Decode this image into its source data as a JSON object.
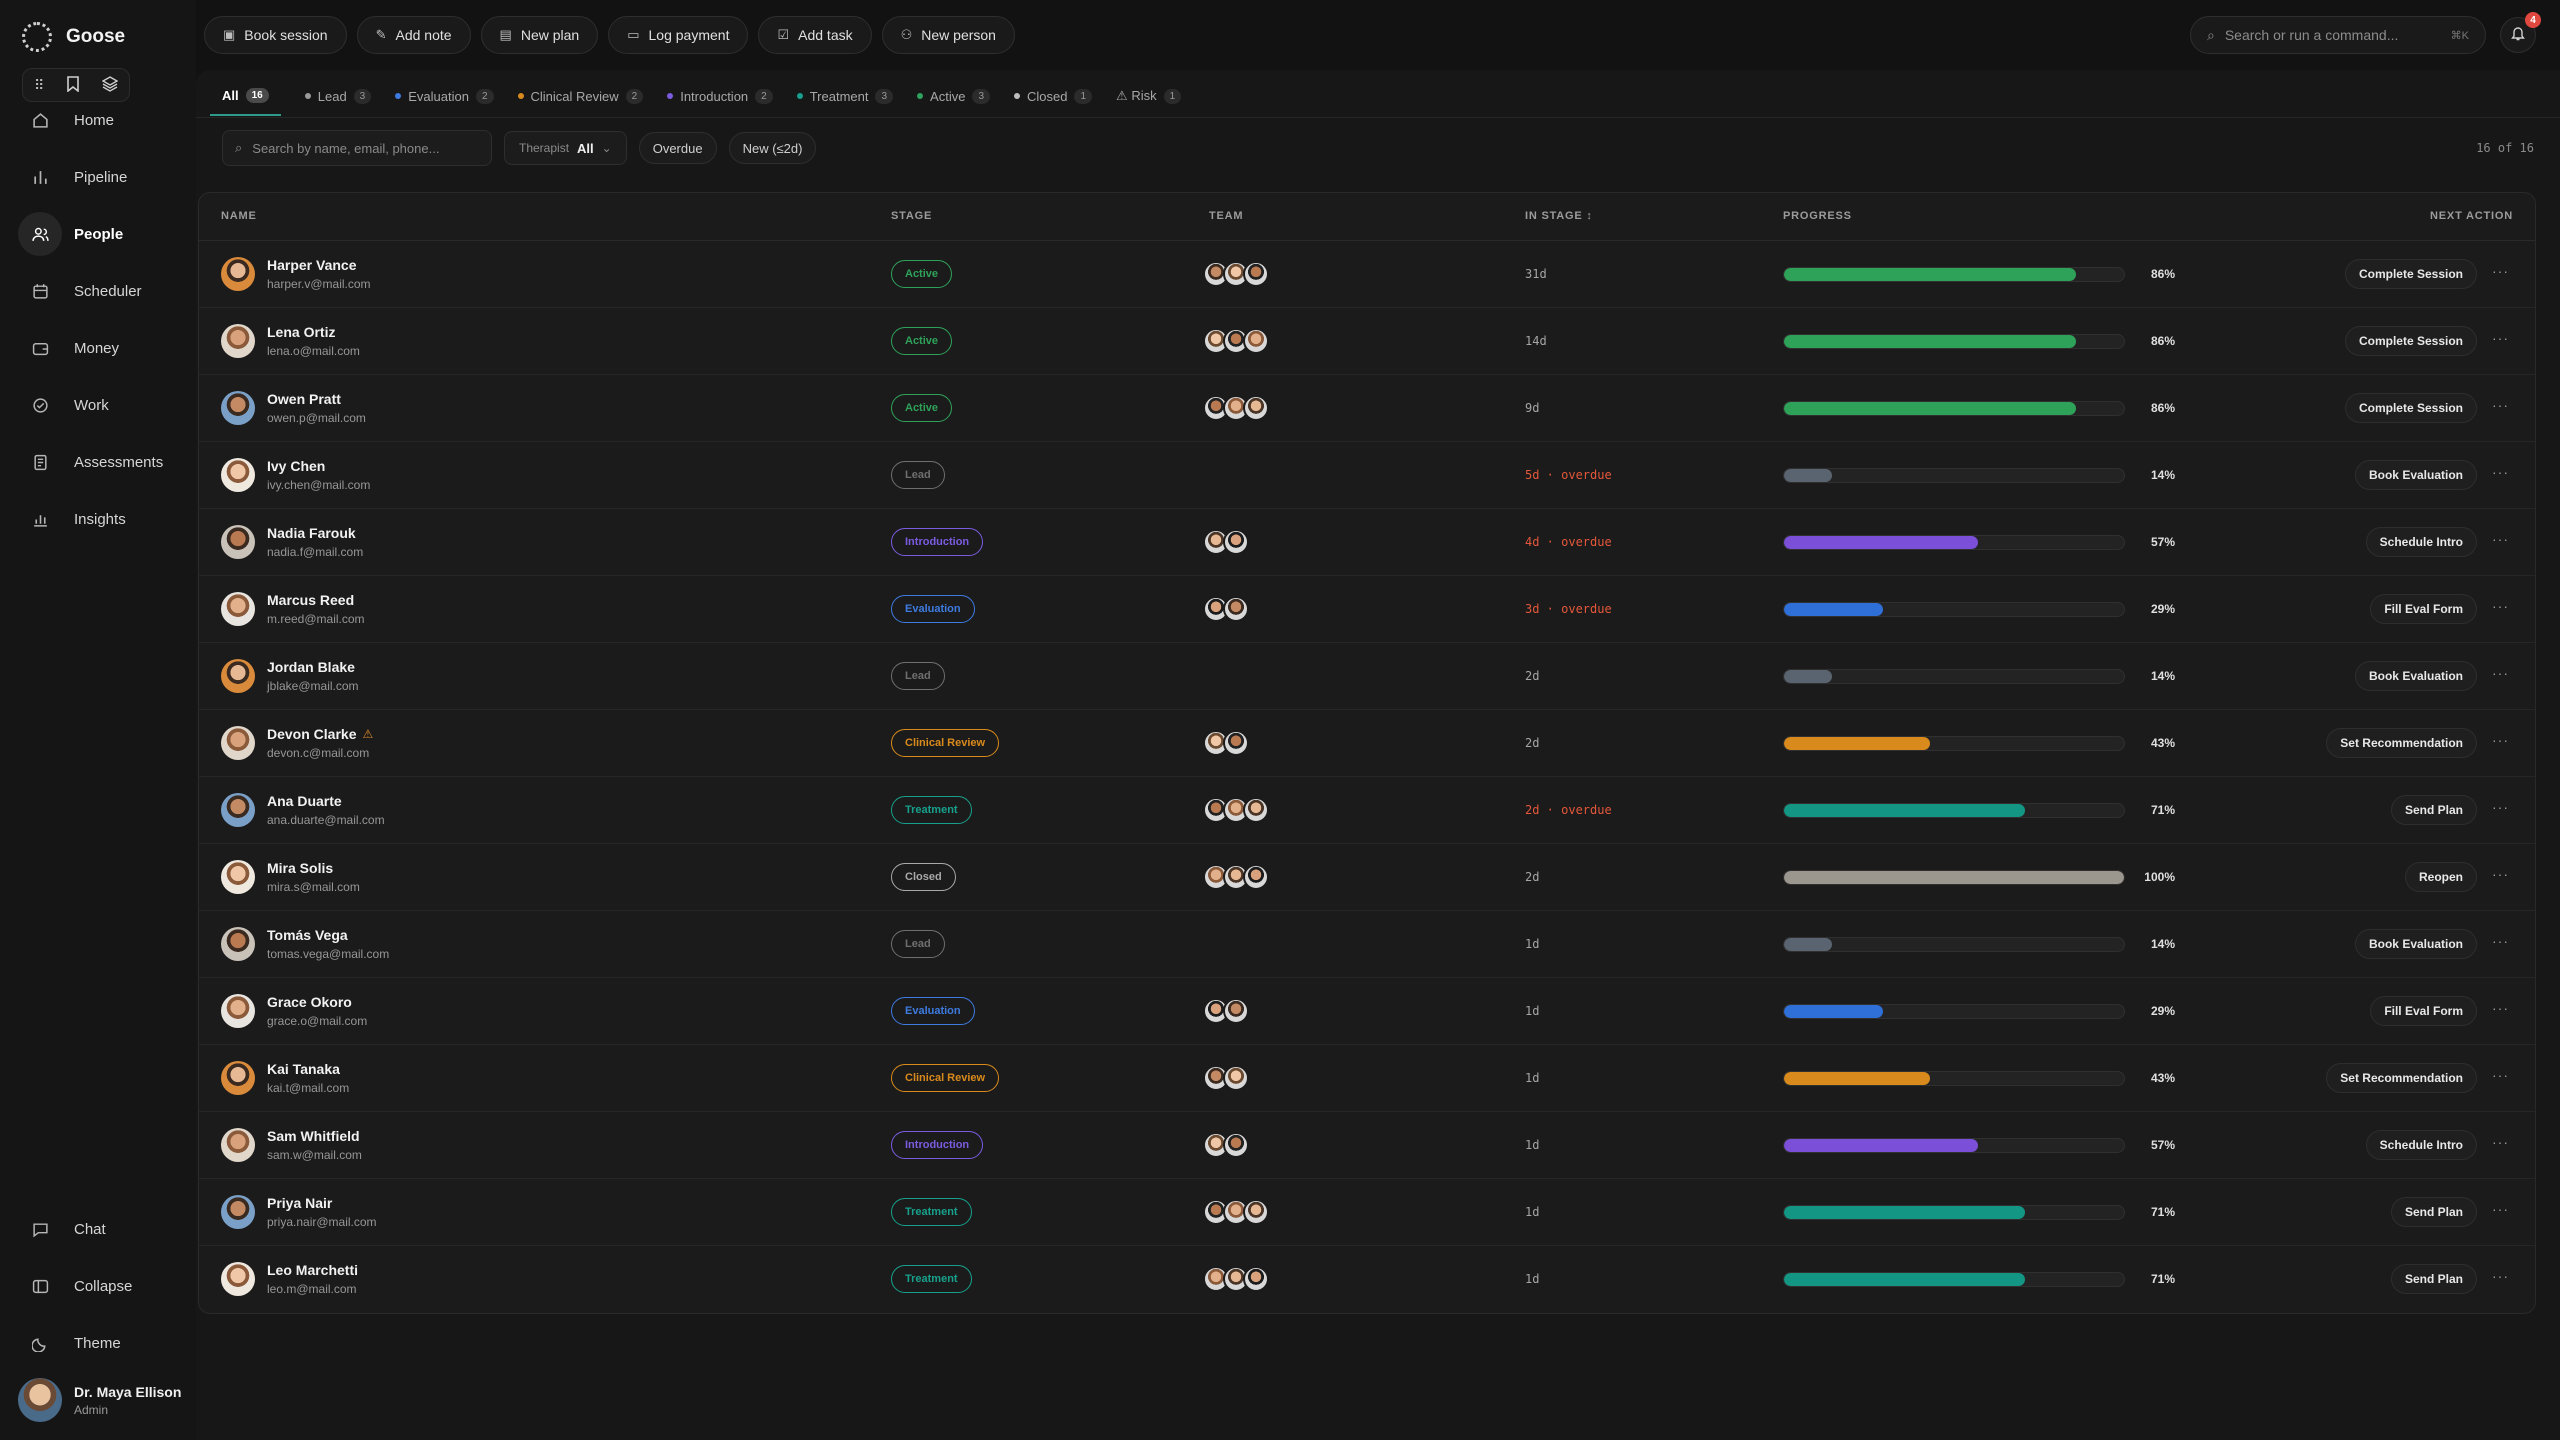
{
  "app": {
    "name": "Goose"
  },
  "toolbar": {
    "book_session": "Book session",
    "add_note": "Add note",
    "new_plan": "New plan",
    "log_payment": "Log payment",
    "add_task": "Add task",
    "new_person": "New person",
    "search_placeholder": "Search or run a command...",
    "search_shortcut": "⌘K",
    "notifications_count": "4"
  },
  "sidebar": {
    "items": [
      {
        "label": "Home",
        "icon": "home-icon"
      },
      {
        "label": "Pipeline",
        "icon": "bar-chart-icon"
      },
      {
        "label": "People",
        "icon": "users-icon"
      },
      {
        "label": "Scheduler",
        "icon": "calendar-icon"
      },
      {
        "label": "Money",
        "icon": "wallet-icon"
      },
      {
        "label": "Work",
        "icon": "check-circle-icon"
      },
      {
        "label": "Assessments",
        "icon": "document-icon"
      },
      {
        "label": "Insights",
        "icon": "chart-icon"
      }
    ],
    "bottom": [
      {
        "label": "Chat",
        "icon": "chat-icon"
      },
      {
        "label": "Collapse",
        "icon": "sidebar-icon"
      },
      {
        "label": "Theme",
        "icon": "moon-icon"
      }
    ],
    "user": {
      "name": "Dr. Maya Ellison",
      "role": "Admin"
    }
  },
  "tabs": [
    {
      "label": "All",
      "count": "16",
      "color": ""
    },
    {
      "label": "Lead",
      "count": "3",
      "color": "#9a9a9a"
    },
    {
      "label": "Evaluation",
      "count": "2",
      "color": "#3d7be0"
    },
    {
      "label": "Clinical Review",
      "count": "2",
      "color": "#d98a1c"
    },
    {
      "label": "Introduction",
      "count": "2",
      "color": "#7b5ce0"
    },
    {
      "label": "Treatment",
      "count": "3",
      "color": "#17a08c"
    },
    {
      "label": "Active",
      "count": "3",
      "color": "#2fa25a"
    },
    {
      "label": "Closed",
      "count": "1",
      "color": "#bdbdbd"
    },
    {
      "label": "⚠ Risk",
      "count": "1",
      "color": ""
    }
  ],
  "filters": {
    "search_placeholder": "Search by name, email, phone...",
    "therapist_label": "Therapist",
    "therapist_value": "All",
    "overdue": "Overdue",
    "new": "New (≤2d)",
    "count_text": "16 of 16"
  },
  "table": {
    "headers": {
      "name": "NAME",
      "stage": "STAGE",
      "team": "TEAM",
      "in_stage": "IN STAGE ↕",
      "progress": "PROGRESS",
      "next_action": "NEXT ACTION"
    },
    "stage_colors": {
      "Active": "#2fa25a",
      "Lead": "#6f6f6f",
      "Introduction": "#7b5ce0",
      "Evaluation": "#3d7be0",
      "Clinical Review": "#d98a1c",
      "Treatment": "#17a08c",
      "Closed": "#a9a9a9"
    },
    "progress_colors": {
      "Active": "#2fa25a",
      "Lead": "#5a6470",
      "Introduction": "#7b4fd8",
      "Evaluation": "#2f6fd8",
      "Clinical Review": "#d98a1c",
      "Treatment": "#139784",
      "Closed": "#9c978e"
    },
    "rows": [
      {
        "name": "Harper Vance",
        "email": "harper.v@mail.com",
        "stage": "Active",
        "team": 3,
        "in_stage": "31d",
        "overdue": false,
        "progress": 86,
        "pct": "86%",
        "action": "Complete Session",
        "warn": ""
      },
      {
        "name": "Lena Ortiz",
        "email": "lena.o@mail.com",
        "stage": "Active",
        "team": 3,
        "in_stage": "14d",
        "overdue": false,
        "progress": 86,
        "pct": "86%",
        "action": "Complete Session",
        "warn": ""
      },
      {
        "name": "Owen Pratt",
        "email": "owen.p@mail.com",
        "stage": "Active",
        "team": 3,
        "in_stage": "9d",
        "overdue": false,
        "progress": 86,
        "pct": "86%",
        "action": "Complete Session",
        "warn": ""
      },
      {
        "name": "Ivy Chen",
        "email": "ivy.chen@mail.com",
        "stage": "Lead",
        "team": 0,
        "in_stage": "5d · overdue",
        "overdue": true,
        "progress": 14,
        "pct": "14%",
        "action": "Book Evaluation",
        "warn": ""
      },
      {
        "name": "Nadia Farouk",
        "email": "nadia.f@mail.com",
        "stage": "Introduction",
        "team": 2,
        "in_stage": "4d · overdue",
        "overdue": true,
        "progress": 57,
        "pct": "57%",
        "action": "Schedule Intro",
        "warn": ""
      },
      {
        "name": "Marcus Reed",
        "email": "m.reed@mail.com",
        "stage": "Evaluation",
        "team": 2,
        "in_stage": "3d · overdue",
        "overdue": true,
        "progress": 29,
        "pct": "29%",
        "action": "Fill Eval Form",
        "warn": ""
      },
      {
        "name": "Jordan Blake",
        "email": "jblake@mail.com",
        "stage": "Lead",
        "team": 0,
        "in_stage": "2d",
        "overdue": false,
        "progress": 14,
        "pct": "14%",
        "action": "Book Evaluation",
        "warn": ""
      },
      {
        "name": "Devon Clarke",
        "email": "devon.c@mail.com",
        "stage": "Clinical Review",
        "team": 2,
        "in_stage": "2d",
        "overdue": false,
        "progress": 43,
        "pct": "43%",
        "action": "Set Recommendation",
        "warn": "⚠"
      },
      {
        "name": "Ana Duarte",
        "email": "ana.duarte@mail.com",
        "stage": "Treatment",
        "team": 3,
        "in_stage": "2d · overdue",
        "overdue": true,
        "progress": 71,
        "pct": "71%",
        "action": "Send Plan",
        "warn": ""
      },
      {
        "name": "Mira Solis",
        "email": "mira.s@mail.com",
        "stage": "Closed",
        "team": 3,
        "in_stage": "2d",
        "overdue": false,
        "progress": 100,
        "pct": "100%",
        "action": "Reopen",
        "warn": ""
      },
      {
        "name": "Tomás Vega",
        "email": "tomas.vega@mail.com",
        "stage": "Lead",
        "team": 0,
        "in_stage": "1d",
        "overdue": false,
        "progress": 14,
        "pct": "14%",
        "action": "Book Evaluation",
        "warn": ""
      },
      {
        "name": "Grace Okoro",
        "email": "grace.o@mail.com",
        "stage": "Evaluation",
        "team": 2,
        "in_stage": "1d",
        "overdue": false,
        "progress": 29,
        "pct": "29%",
        "action": "Fill Eval Form",
        "warn": ""
      },
      {
        "name": "Kai Tanaka",
        "email": "kai.t@mail.com",
        "stage": "Clinical Review",
        "team": 2,
        "in_stage": "1d",
        "overdue": false,
        "progress": 43,
        "pct": "43%",
        "action": "Set Recommendation",
        "warn": ""
      },
      {
        "name": "Sam Whitfield",
        "email": "sam.w@mail.com",
        "stage": "Introduction",
        "team": 2,
        "in_stage": "1d",
        "overdue": false,
        "progress": 57,
        "pct": "57%",
        "action": "Schedule Intro",
        "warn": ""
      },
      {
        "name": "Priya Nair",
        "email": "priya.nair@mail.com",
        "stage": "Treatment",
        "team": 3,
        "in_stage": "1d",
        "overdue": false,
        "progress": 71,
        "pct": "71%",
        "action": "Send Plan",
        "warn": ""
      },
      {
        "name": "Leo Marchetti",
        "email": "leo.m@mail.com",
        "stage": "Treatment",
        "team": 3,
        "in_stage": "1d",
        "overdue": false,
        "progress": 71,
        "pct": "71%",
        "action": "Send Plan",
        "warn": ""
      }
    ]
  }
}
